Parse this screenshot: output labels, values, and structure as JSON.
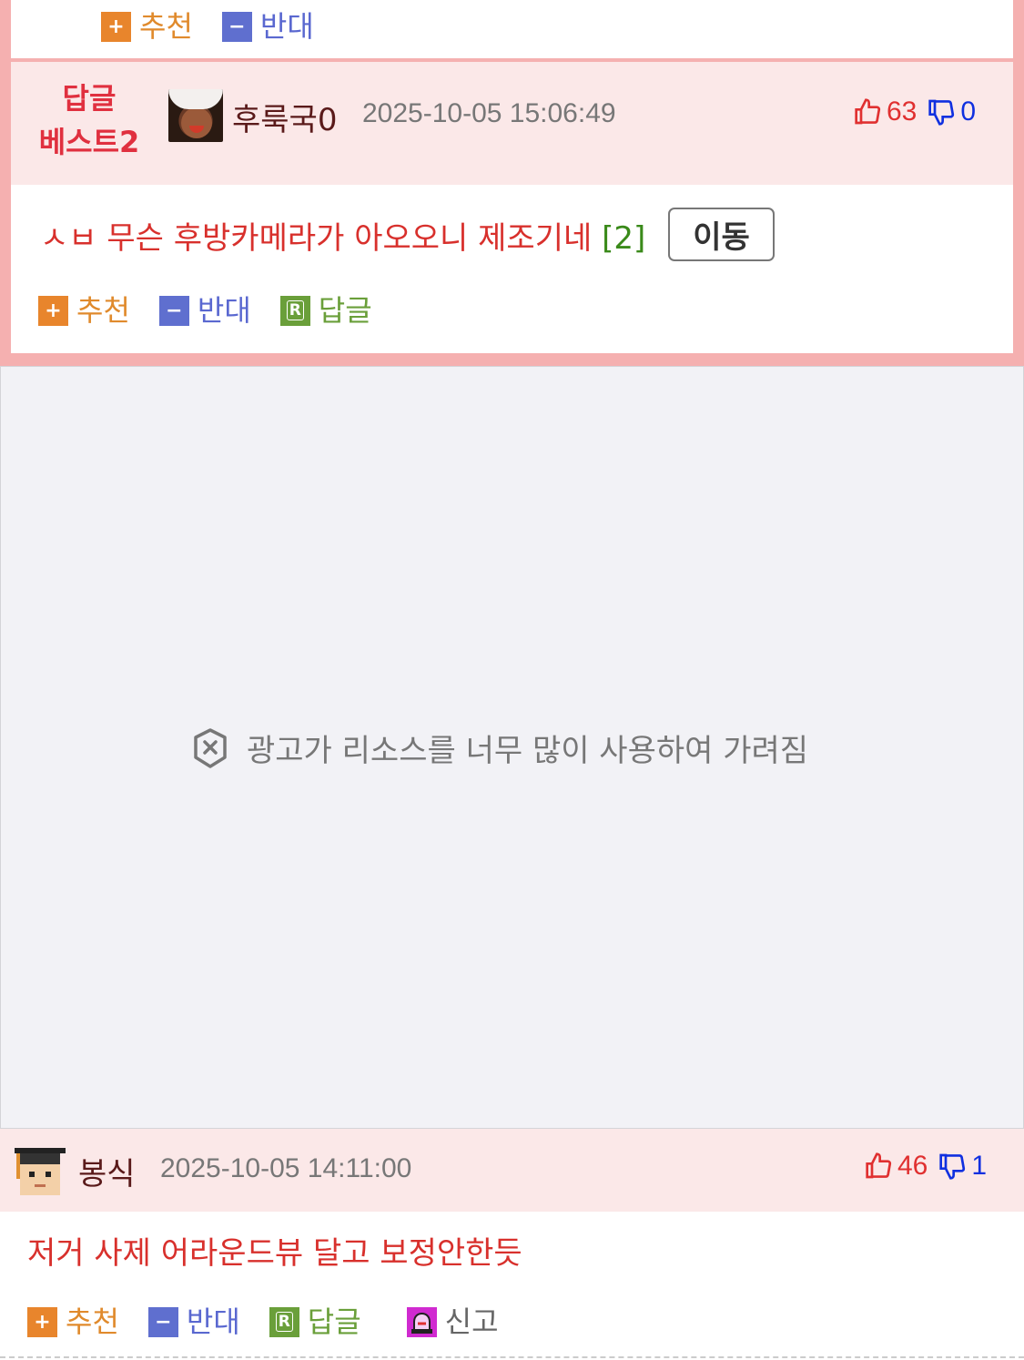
{
  "labels": {
    "recommend": "추천",
    "oppose": "반대",
    "reply": "답글",
    "report": "신고",
    "reply_icon_letter": "R",
    "plus_icon": "+",
    "minus_icon": "−"
  },
  "best_comment": {
    "badge_line1": "답글",
    "badge_line2": "베스트2",
    "nickname": "후룩국0",
    "datetime": "2025-10-05 15:06:49",
    "likes": "63",
    "dislikes": "0",
    "text": "ㅅㅂ 무슨 후방카메라가 아오오니 제조기네",
    "reply_count": "[2]",
    "move_button": "이동"
  },
  "ad": {
    "message": "광고가 리소스를 너무 많이 사용하여 가려짐",
    "icon": "shield-x-icon"
  },
  "comment2": {
    "nickname": "봉식",
    "datetime": "2025-10-05 14:11:00",
    "likes": "46",
    "dislikes": "1",
    "text": "저거 사제 어라운드뷰 달고 보정안한듯"
  },
  "colors": {
    "best_border": "#f5b0b0",
    "header_bg": "#fbe8e8",
    "comment_text": "#d8302c",
    "like": "#e03030",
    "dislike": "#1030e0"
  }
}
